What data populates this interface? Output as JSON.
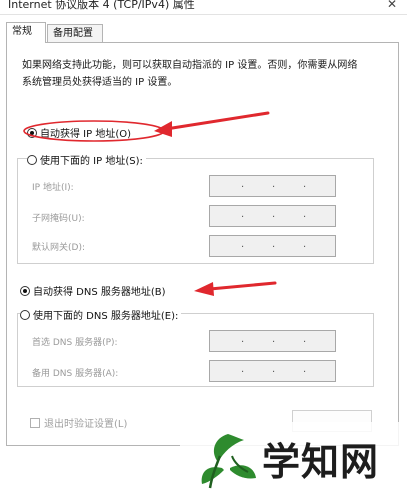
{
  "window": {
    "title": "Internet 协议版本 4 (TCP/IPv4) 属性"
  },
  "tabs": [
    {
      "label": "常规",
      "active": true
    },
    {
      "label": "备用配置",
      "active": false
    }
  ],
  "description": "如果网络支持此功能，则可以获取自动指派的 IP 设置。否则，你需要从网络系统管理员处获得适当的 IP 设置。",
  "ip_section": {
    "auto_label": "自动获得 IP 地址(O)",
    "auto_selected": true,
    "manual_label": "使用下面的 IP 地址(S):",
    "fields": [
      {
        "label": "IP 地址(I):",
        "value": ". . ."
      },
      {
        "label": "子网掩码(U):",
        "value": ". . ."
      },
      {
        "label": "默认网关(D):",
        "value": ". . ."
      }
    ]
  },
  "dns_section": {
    "auto_label": "自动获得 DNS 服务器地址(B)",
    "auto_selected": true,
    "manual_label": "使用下面的 DNS 服务器地址(E):",
    "fields": [
      {
        "label": "首选 DNS 服务器(P):",
        "value": ". . ."
      },
      {
        "label": "备用 DNS 服务器(A):",
        "value": ". . ."
      }
    ]
  },
  "validate_checkbox": {
    "label": "退出时验证设置(L)",
    "checked": false
  },
  "annotation": {
    "arrow_color": "#e0282e"
  },
  "watermark": {
    "text": "学知网",
    "logo_icon": "leaf-logo",
    "logo_color": "#2e8b2e"
  },
  "colors": {
    "panel_border": "#b4b4b4",
    "disabled_text": "#9a9a9a",
    "ip_box_bg": "#f0f0f0"
  }
}
